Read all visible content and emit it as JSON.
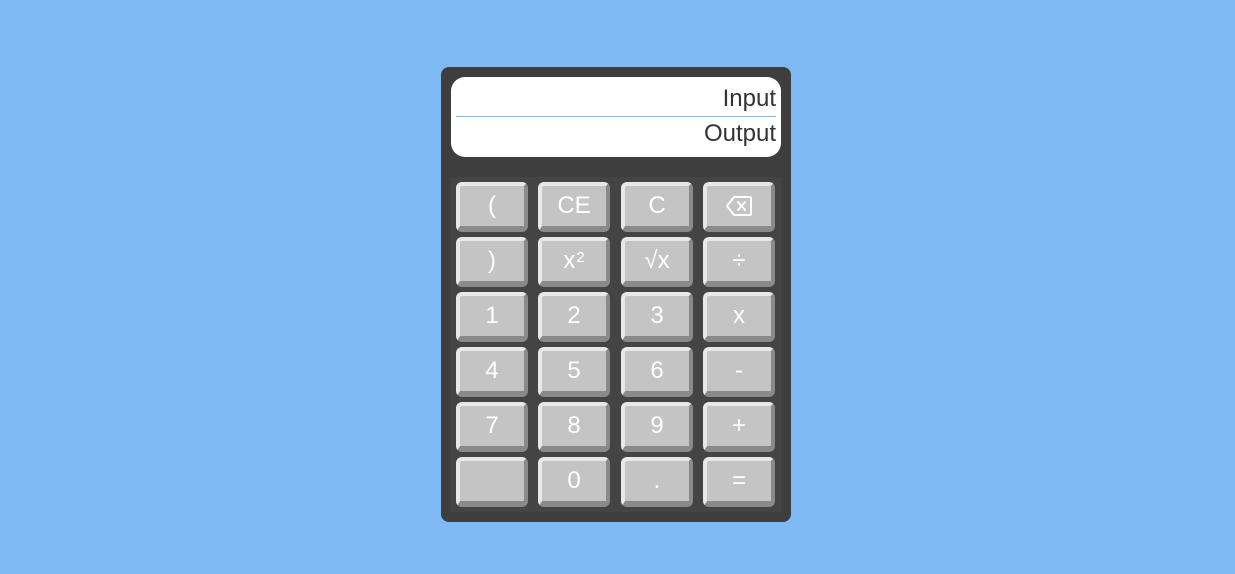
{
  "display": {
    "input": "Input",
    "output": "Output"
  },
  "keys": {
    "open_paren": "(",
    "clear_entry": "CE",
    "clear": "C",
    "backspace_icon": "backspace-icon",
    "close_paren": ")",
    "square_base": "x",
    "square_exp": "2",
    "sqrt": "√x",
    "divide": "÷",
    "one": "1",
    "two": "2",
    "three": "3",
    "multiply": "x",
    "four": "4",
    "five": "5",
    "six": "6",
    "minus": "-",
    "seven": "7",
    "eight": "8",
    "nine": "9",
    "plus": "+",
    "blank": "",
    "zero": "0",
    "decimal": ".",
    "equals": "="
  },
  "colors": {
    "background": "#7eb9f3",
    "calculator_body": "#3e3e3e",
    "key_face": "#c4c4c4",
    "key_text": "#ffffff"
  }
}
